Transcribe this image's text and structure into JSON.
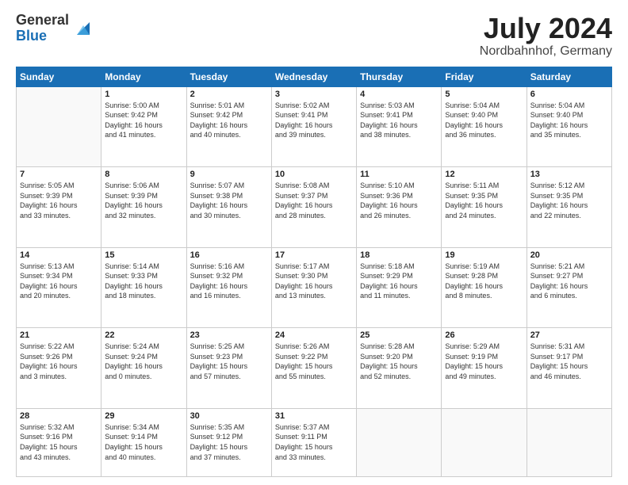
{
  "header": {
    "logo_general": "General",
    "logo_blue": "Blue",
    "title": "July 2024",
    "location": "Nordbahnhof, Germany"
  },
  "days_of_week": [
    "Sunday",
    "Monday",
    "Tuesday",
    "Wednesday",
    "Thursday",
    "Friday",
    "Saturday"
  ],
  "weeks": [
    [
      {
        "day": "",
        "info": ""
      },
      {
        "day": "1",
        "info": "Sunrise: 5:00 AM\nSunset: 9:42 PM\nDaylight: 16 hours\nand 41 minutes."
      },
      {
        "day": "2",
        "info": "Sunrise: 5:01 AM\nSunset: 9:42 PM\nDaylight: 16 hours\nand 40 minutes."
      },
      {
        "day": "3",
        "info": "Sunrise: 5:02 AM\nSunset: 9:41 PM\nDaylight: 16 hours\nand 39 minutes."
      },
      {
        "day": "4",
        "info": "Sunrise: 5:03 AM\nSunset: 9:41 PM\nDaylight: 16 hours\nand 38 minutes."
      },
      {
        "day": "5",
        "info": "Sunrise: 5:04 AM\nSunset: 9:40 PM\nDaylight: 16 hours\nand 36 minutes."
      },
      {
        "day": "6",
        "info": "Sunrise: 5:04 AM\nSunset: 9:40 PM\nDaylight: 16 hours\nand 35 minutes."
      }
    ],
    [
      {
        "day": "7",
        "info": "Sunrise: 5:05 AM\nSunset: 9:39 PM\nDaylight: 16 hours\nand 33 minutes."
      },
      {
        "day": "8",
        "info": "Sunrise: 5:06 AM\nSunset: 9:39 PM\nDaylight: 16 hours\nand 32 minutes."
      },
      {
        "day": "9",
        "info": "Sunrise: 5:07 AM\nSunset: 9:38 PM\nDaylight: 16 hours\nand 30 minutes."
      },
      {
        "day": "10",
        "info": "Sunrise: 5:08 AM\nSunset: 9:37 PM\nDaylight: 16 hours\nand 28 minutes."
      },
      {
        "day": "11",
        "info": "Sunrise: 5:10 AM\nSunset: 9:36 PM\nDaylight: 16 hours\nand 26 minutes."
      },
      {
        "day": "12",
        "info": "Sunrise: 5:11 AM\nSunset: 9:35 PM\nDaylight: 16 hours\nand 24 minutes."
      },
      {
        "day": "13",
        "info": "Sunrise: 5:12 AM\nSunset: 9:35 PM\nDaylight: 16 hours\nand 22 minutes."
      }
    ],
    [
      {
        "day": "14",
        "info": "Sunrise: 5:13 AM\nSunset: 9:34 PM\nDaylight: 16 hours\nand 20 minutes."
      },
      {
        "day": "15",
        "info": "Sunrise: 5:14 AM\nSunset: 9:33 PM\nDaylight: 16 hours\nand 18 minutes."
      },
      {
        "day": "16",
        "info": "Sunrise: 5:16 AM\nSunset: 9:32 PM\nDaylight: 16 hours\nand 16 minutes."
      },
      {
        "day": "17",
        "info": "Sunrise: 5:17 AM\nSunset: 9:30 PM\nDaylight: 16 hours\nand 13 minutes."
      },
      {
        "day": "18",
        "info": "Sunrise: 5:18 AM\nSunset: 9:29 PM\nDaylight: 16 hours\nand 11 minutes."
      },
      {
        "day": "19",
        "info": "Sunrise: 5:19 AM\nSunset: 9:28 PM\nDaylight: 16 hours\nand 8 minutes."
      },
      {
        "day": "20",
        "info": "Sunrise: 5:21 AM\nSunset: 9:27 PM\nDaylight: 16 hours\nand 6 minutes."
      }
    ],
    [
      {
        "day": "21",
        "info": "Sunrise: 5:22 AM\nSunset: 9:26 PM\nDaylight: 16 hours\nand 3 minutes."
      },
      {
        "day": "22",
        "info": "Sunrise: 5:24 AM\nSunset: 9:24 PM\nDaylight: 16 hours\nand 0 minutes."
      },
      {
        "day": "23",
        "info": "Sunrise: 5:25 AM\nSunset: 9:23 PM\nDaylight: 15 hours\nand 57 minutes."
      },
      {
        "day": "24",
        "info": "Sunrise: 5:26 AM\nSunset: 9:22 PM\nDaylight: 15 hours\nand 55 minutes."
      },
      {
        "day": "25",
        "info": "Sunrise: 5:28 AM\nSunset: 9:20 PM\nDaylight: 15 hours\nand 52 minutes."
      },
      {
        "day": "26",
        "info": "Sunrise: 5:29 AM\nSunset: 9:19 PM\nDaylight: 15 hours\nand 49 minutes."
      },
      {
        "day": "27",
        "info": "Sunrise: 5:31 AM\nSunset: 9:17 PM\nDaylight: 15 hours\nand 46 minutes."
      }
    ],
    [
      {
        "day": "28",
        "info": "Sunrise: 5:32 AM\nSunset: 9:16 PM\nDaylight: 15 hours\nand 43 minutes."
      },
      {
        "day": "29",
        "info": "Sunrise: 5:34 AM\nSunset: 9:14 PM\nDaylight: 15 hours\nand 40 minutes."
      },
      {
        "day": "30",
        "info": "Sunrise: 5:35 AM\nSunset: 9:12 PM\nDaylight: 15 hours\nand 37 minutes."
      },
      {
        "day": "31",
        "info": "Sunrise: 5:37 AM\nSunset: 9:11 PM\nDaylight: 15 hours\nand 33 minutes."
      },
      {
        "day": "",
        "info": ""
      },
      {
        "day": "",
        "info": ""
      },
      {
        "day": "",
        "info": ""
      }
    ]
  ]
}
